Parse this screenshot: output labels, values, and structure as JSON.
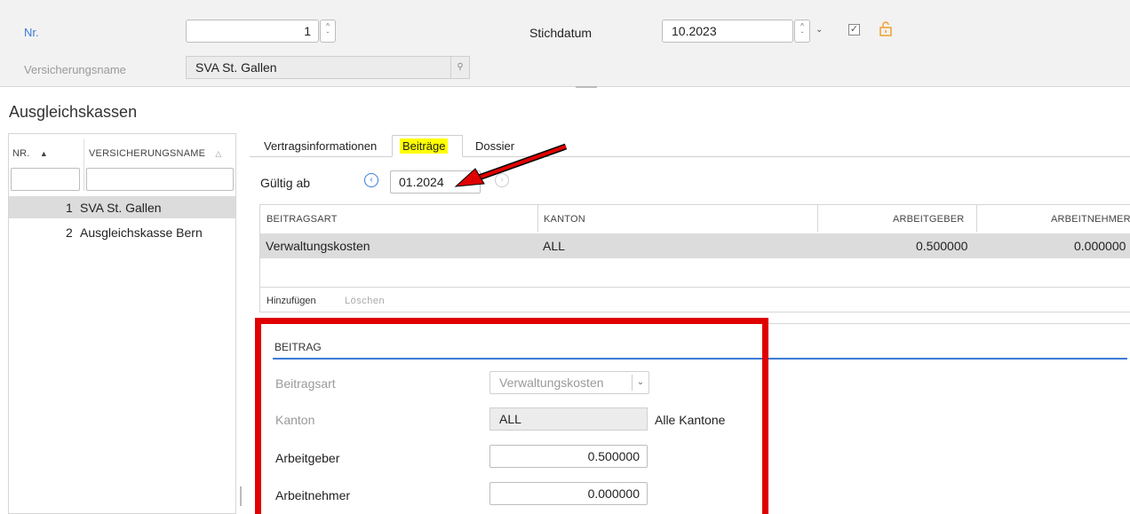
{
  "header": {
    "nr_label": "Nr.",
    "nr_value": "1",
    "stichdatum_label": "Stichdatum",
    "stichdatum_value": "10.2023",
    "versicherungsname_label": "Versicherungsname",
    "versicherungsname_value": "SVA St. Gallen"
  },
  "section_title": "Ausgleichskassen",
  "list": {
    "col_nr": "NR.",
    "col_name": "VERSICHERUNGSNAME",
    "rows": [
      {
        "nr": "1",
        "name": "SVA St. Gallen"
      },
      {
        "nr": "2",
        "name": "Ausgleichskasse Bern"
      }
    ]
  },
  "tabs": [
    "Vertragsinformationen",
    "Beiträge",
    "Dossier"
  ],
  "active_tab": "Beiträge",
  "gueltig": {
    "label": "Gültig ab",
    "value": "01.2024"
  },
  "table": {
    "headers": [
      "BEITRAGSART",
      "KANTON",
      "ARBEITGEBER",
      "ARBEITNEHMER"
    ],
    "rows": [
      {
        "beitragsart": "Verwaltungskosten",
        "kanton": "ALL",
        "arbeitgeber": "0.500000",
        "arbeitnehmer": "0.000000"
      }
    ]
  },
  "actions": {
    "add": "Hinzufügen",
    "delete": "Löschen"
  },
  "detail": {
    "title": "BEITRAG",
    "beitragsart_label": "Beitragsart",
    "beitragsart_value": "Verwaltungskosten",
    "kanton_label": "Kanton",
    "kanton_value": "ALL",
    "kanton_desc": "Alle Kantone",
    "arbeitgeber_label": "Arbeitgeber",
    "arbeitgeber_value": "0.500000",
    "arbeitnehmer_label": "Arbeitnehmer",
    "arbeitnehmer_value": "0.000000"
  },
  "colors": {
    "accent": "#3a7bd5",
    "highlight": "#ffff00",
    "annotation": "#e00000",
    "lock": "#f0a030"
  }
}
